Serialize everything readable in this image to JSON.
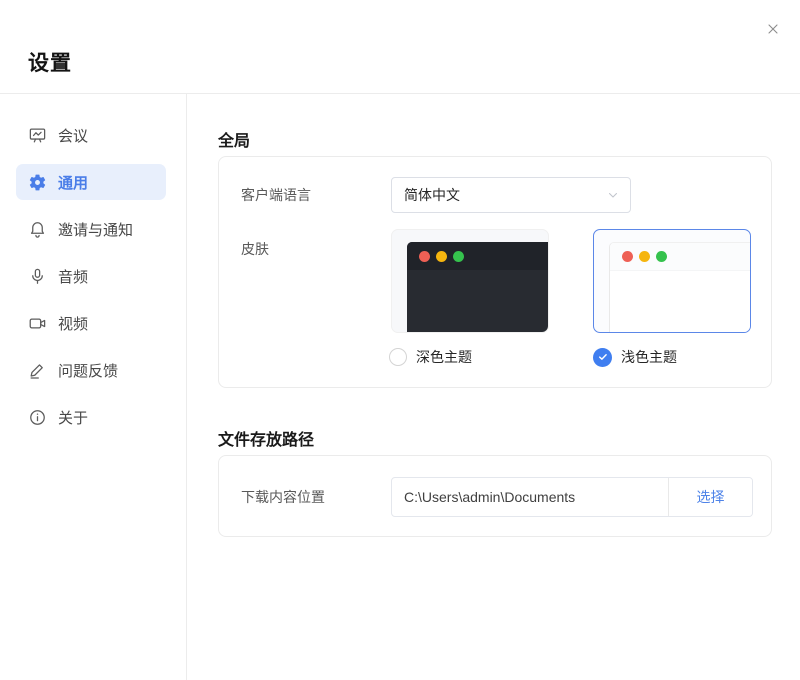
{
  "window": {
    "title": "设置",
    "close_icon": "close-x"
  },
  "sidebar": {
    "items": [
      {
        "label": "会议",
        "icon": "meeting-board-icon",
        "selected": false
      },
      {
        "label": "通用",
        "icon": "gear-icon",
        "selected": true
      },
      {
        "label": "邀请与通知",
        "icon": "bell-icon",
        "selected": false
      },
      {
        "label": "音频",
        "icon": "microphone-icon",
        "selected": false
      },
      {
        "label": "视频",
        "icon": "video-camera-icon",
        "selected": false
      },
      {
        "label": "问题反馈",
        "icon": "pencil-icon",
        "selected": false
      },
      {
        "label": "关于",
        "icon": "info-icon",
        "selected": false
      }
    ]
  },
  "general": {
    "section_title": "全局",
    "language": {
      "label": "客户端语言",
      "value": "简体中文"
    },
    "theme": {
      "label": "皮肤",
      "options": [
        {
          "label": "深色主题",
          "selected": false,
          "style": "dark"
        },
        {
          "label": "浅色主题",
          "selected": true,
          "style": "light"
        }
      ],
      "traffic_dots": [
        "#ee6055",
        "#f5b50f",
        "#35c24d"
      ]
    }
  },
  "storage": {
    "section_title": "文件存放路径",
    "download": {
      "label": "下载内容位置",
      "path": "C:\\Users\\admin\\Documents",
      "button_label": "选择"
    }
  },
  "colors": {
    "accent": "#4a7de8",
    "selected_item_bg": "#e8effc",
    "check_circle": "#3f7ef0",
    "dark_preview_header": "#202329",
    "dark_preview_body": "#282b31"
  }
}
